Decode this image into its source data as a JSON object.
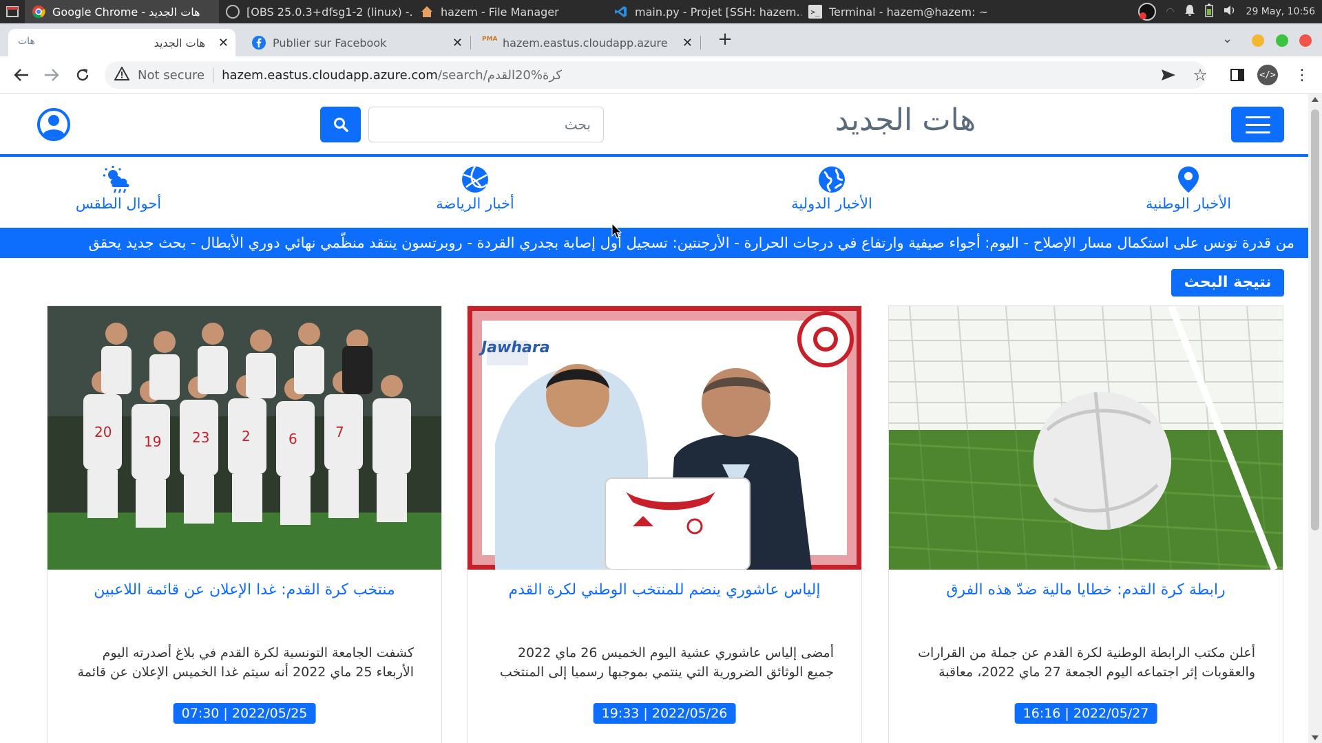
{
  "os": {
    "tasks": [
      {
        "label": "Google Chrome - هات الجديد"
      },
      {
        "label": "[OBS 25.0.3+dfsg1-2 (linux) -..."
      },
      {
        "label": "hazem - File Manager"
      },
      {
        "label": "main.py - Projet [SSH: hazem..."
      },
      {
        "label": "Terminal - hazem@hazem: ~"
      }
    ],
    "clock": "29 May, 10:56"
  },
  "browser": {
    "tabs": [
      {
        "label": "هات الجديد"
      },
      {
        "label": "Publier sur Facebook"
      },
      {
        "label": "hazem.eastus.cloudapp.azure.co"
      }
    ],
    "security_label": "Not secure",
    "url_host": "hazem.eastus.cloudapp.azure.com",
    "url_path": "/search/كرة%20القدم"
  },
  "site": {
    "logo_text": "هات الجديد",
    "search_placeholder": "بحث",
    "categories": [
      {
        "label": "الأخبار الوطنية",
        "icon": "map-pin-icon"
      },
      {
        "label": "الأخبار الدولية",
        "icon": "globe-icon"
      },
      {
        "label": "أخبار الرياضة",
        "icon": "volleyball-icon"
      },
      {
        "label": "أحوال الطقس",
        "icon": "weather-icon"
      }
    ],
    "ticker": "من قدرة تونس على استكمال مسار الإصلاح - اليوم: أجواء صيفية وارتفاع في درجات الحرارة - الأرجنتين: تسجيل أول إصابة بجدري القردة - روبرتسون ينتقد منظّمي نهائي دوري الأبطال - بحث جديد يحقق",
    "results_label": "نتيجة البحث"
  },
  "articles": [
    {
      "title": "رابطة كرة القدم: خطايا مالية ضدّ هذه الفرق",
      "description": "أعلن مكتب الرابطة الوطنية لكرة القدم عن جملة من القرارات والعقوبات إثر اجتماعه اليوم الجمعة 27 ماي 2022، معاقبة",
      "date": "16:16 | 2022/05/27",
      "image": "soccer-ball-in-net"
    },
    {
      "title": "إلياس عاشوري ينضم للمنتخب الوطني لكرة القدم",
      "description": "أمضى إلياس عاشوري عشية اليوم الخميس 26 ماي 2022 جميع الوثائق الضرورية التي ينتمي بموجبها رسميا إلى المنتخب",
      "date": "19:33 | 2022/05/26",
      "image": "player-signing-photo",
      "image_caption": "Jawhara"
    },
    {
      "title": "منتخب كرة القدم: غدا الإعلان عن قائمة اللاعبين",
      "description": "كشفت الجامعة التونسية لكرة القدم في بلاغ أصدرته اليوم الأربعاء 25 ماي 2022 أنه سيتم غدا الخميس الإعلان عن قائمة",
      "date": "07:30 | 2022/05/25",
      "image": "team-photo"
    }
  ]
}
